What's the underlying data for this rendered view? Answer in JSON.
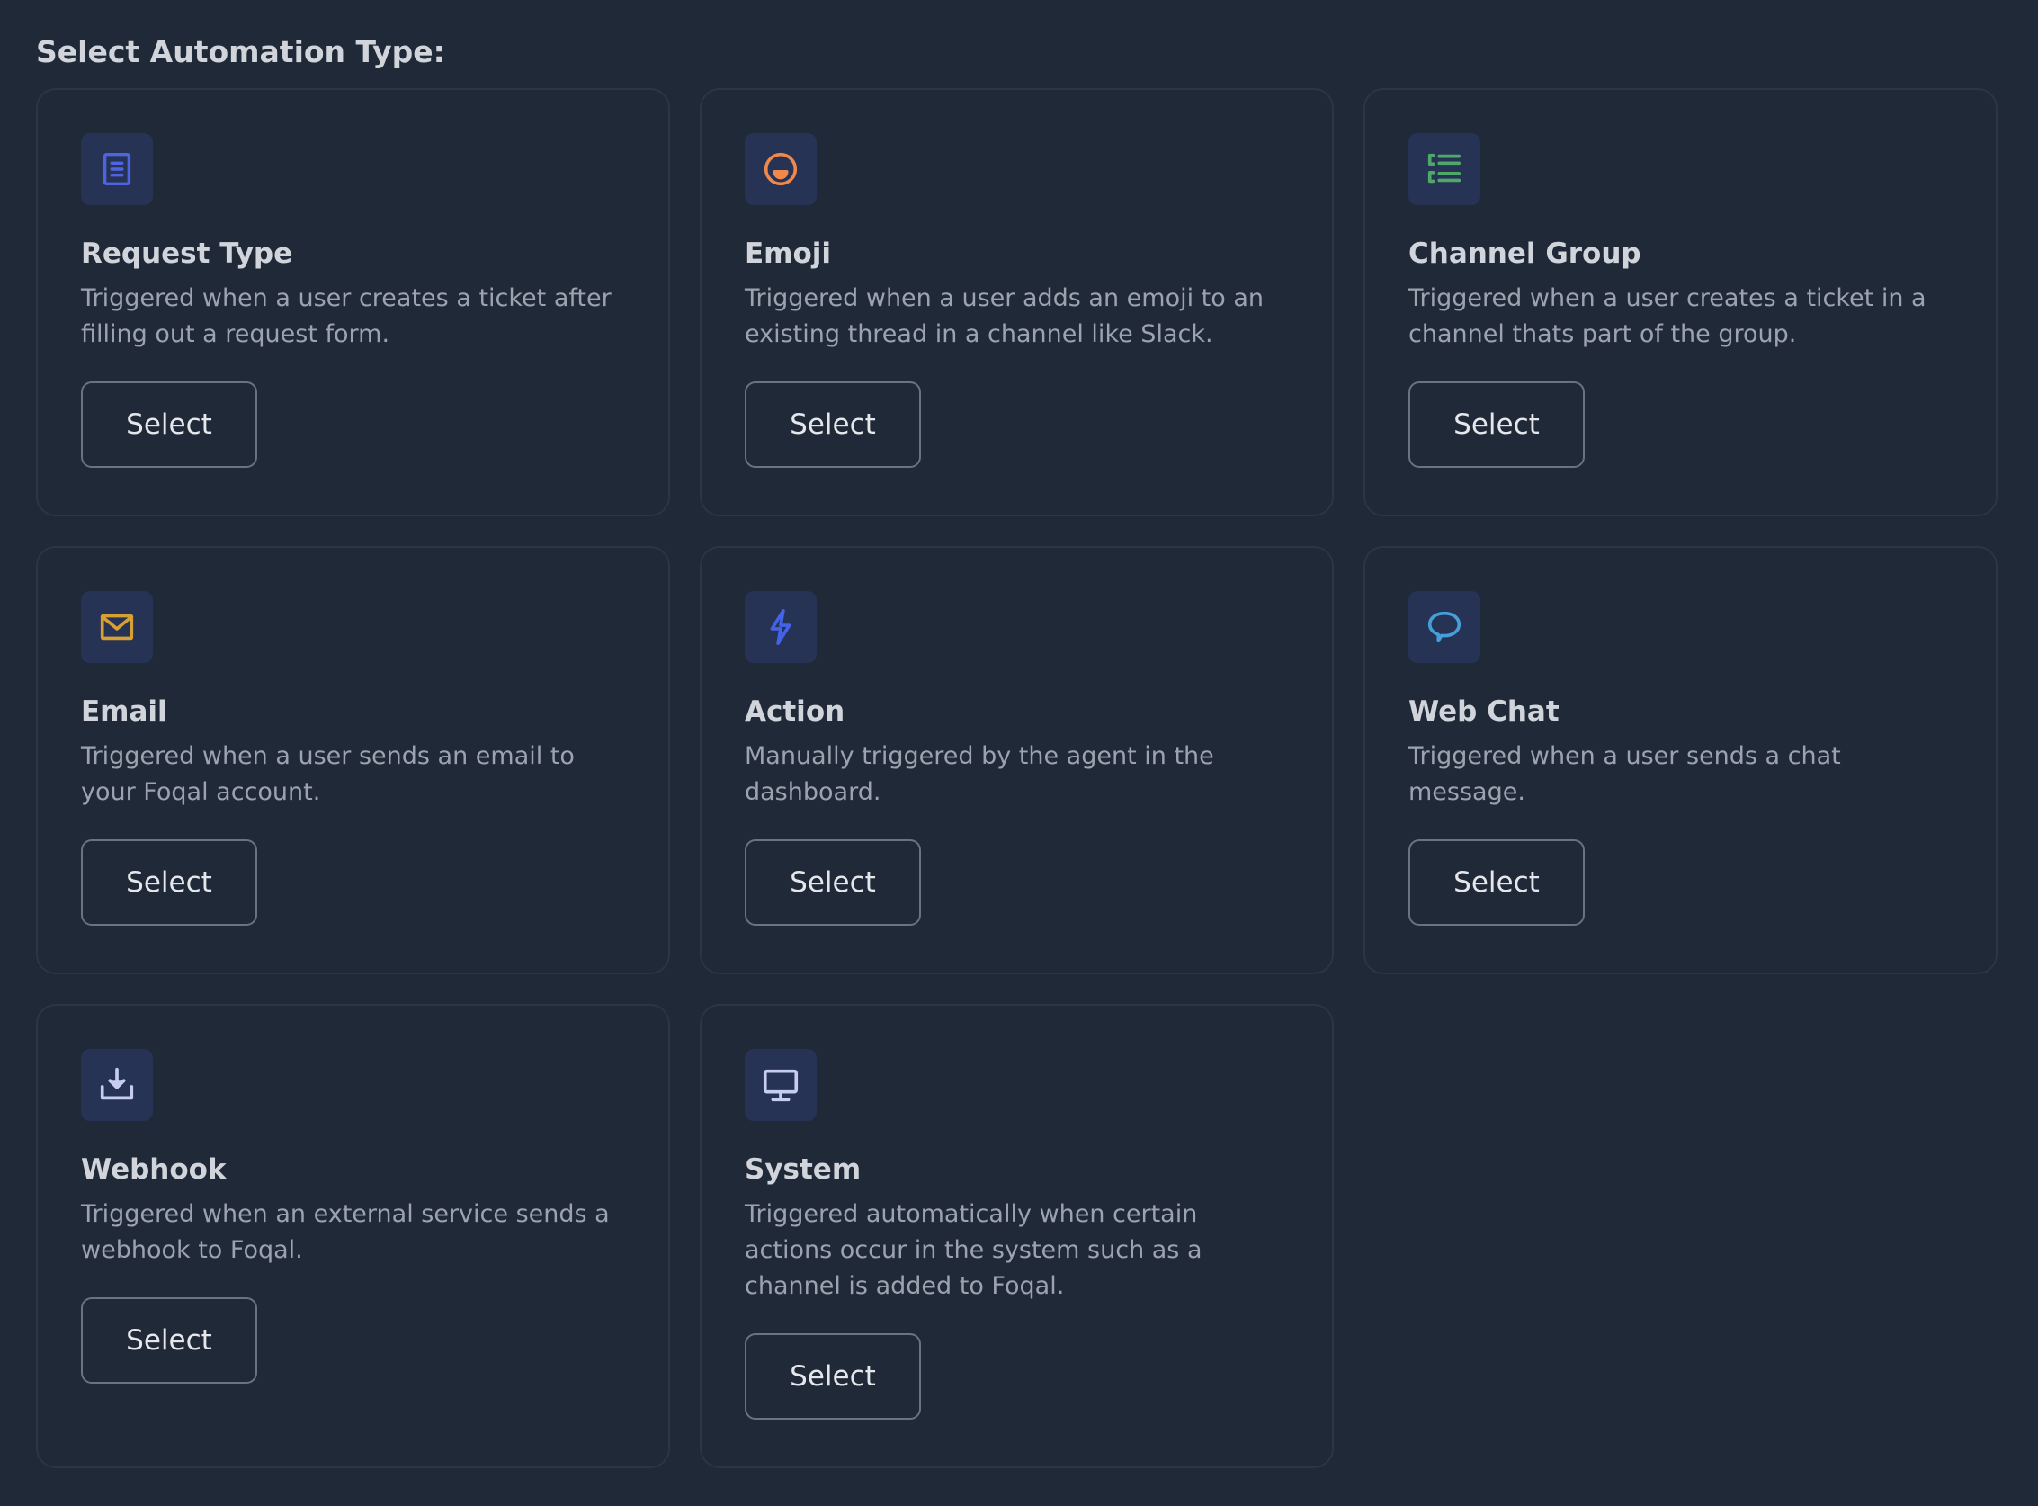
{
  "page": {
    "title": "Select Automation Type:"
  },
  "colors": {
    "background": "#1f2937",
    "icon_bg": "#273354",
    "request_type_icon": "#4f64e0",
    "emoji_icon": "#f0884b",
    "channel_group_icon": "#4fa76a",
    "email_icon": "#d7a033",
    "action_icon": "#4562ea",
    "web_chat_icon": "#44a0d8",
    "webhook_icon": "#c7cdf0",
    "system_icon": "#c7cdf0"
  },
  "cards": [
    {
      "icon": "document-icon",
      "title": "Request Type",
      "description": "Triggered when a user creates a ticket after filling out a request form.",
      "button_label": "Select"
    },
    {
      "icon": "emoji-icon",
      "title": "Emoji",
      "description": "Triggered when a user adds an emoji to an existing thread in a channel like Slack.",
      "button_label": "Select"
    },
    {
      "icon": "list-icon",
      "title": "Channel Group",
      "description": "Triggered when a user creates a ticket in a channel thats part of the group.",
      "button_label": "Select"
    },
    {
      "icon": "envelope-icon",
      "title": "Email",
      "description": "Triggered when a user sends an email to your Foqal account.",
      "button_label": "Select"
    },
    {
      "icon": "lightning-icon",
      "title": "Action",
      "description": "Manually triggered by the agent in the dashboard.",
      "button_label": "Select"
    },
    {
      "icon": "chat-bubble-icon",
      "title": "Web Chat",
      "description": "Triggered when a user sends a chat message.",
      "button_label": "Select"
    },
    {
      "icon": "download-icon",
      "title": "Webhook",
      "description": "Triggered when an external service sends a webhook to Foqal.",
      "button_label": "Select"
    },
    {
      "icon": "monitor-icon",
      "title": "System",
      "description": "Triggered automatically when certain actions occur in the system such as a channel is added to Foqal.",
      "button_label": "Select"
    }
  ]
}
